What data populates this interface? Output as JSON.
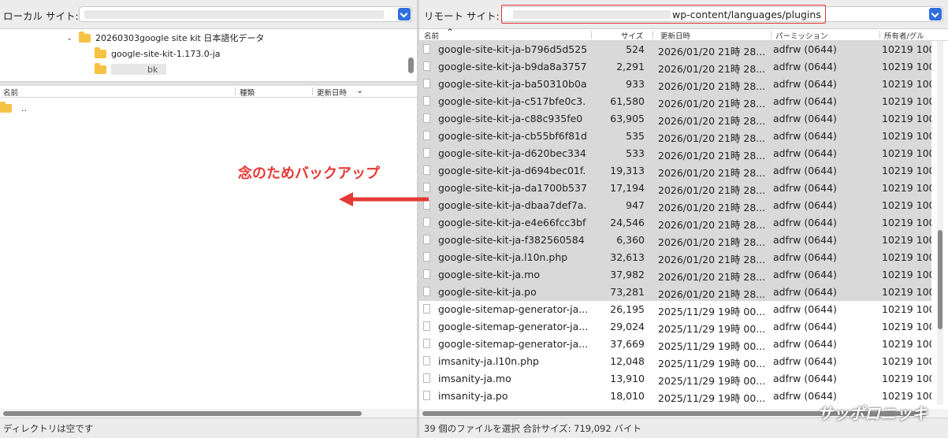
{
  "local": {
    "site_label": "ローカル サイト:",
    "tree": [
      {
        "label": "20260303google site kit 日本語化データ"
      },
      {
        "label": "google-site-kit-1.173.0-ja"
      },
      {
        "label": "bk"
      }
    ],
    "columns": [
      "名前",
      "種類",
      "更新日時"
    ],
    "parent_dir": "..",
    "status": "ディレクトリは空です"
  },
  "remote": {
    "site_label": "リモート サイト:",
    "path": "wp-content/languages/plugins",
    "columns": [
      "名前",
      "サイズ",
      "更新日時",
      "パーミッション",
      "所有者/グル"
    ],
    "files": [
      {
        "name": "google-site-kit-ja-b796d5d525",
        "size": "524",
        "date": "2026/01/20 21時 28...",
        "perm": "adfrw (0644)",
        "owner": "10219 100",
        "selected": true
      },
      {
        "name": "google-site-kit-ja-b9da8a3757",
        "size": "2,291",
        "date": "2026/01/20 21時 28...",
        "perm": "adfrw (0644)",
        "owner": "10219 100",
        "selected": true
      },
      {
        "name": "google-site-kit-ja-ba50310b0a",
        "size": "933",
        "date": "2026/01/20 21時 28...",
        "perm": "adfrw (0644)",
        "owner": "10219 100",
        "selected": true
      },
      {
        "name": "google-site-kit-ja-c517bfe0c3.",
        "size": "61,580",
        "date": "2026/01/20 21時 28...",
        "perm": "adfrw (0644)",
        "owner": "10219 100",
        "selected": true
      },
      {
        "name": "google-site-kit-ja-c88c935fe0",
        "size": "63,905",
        "date": "2026/01/20 21時 28...",
        "perm": "adfrw (0644)",
        "owner": "10219 100",
        "selected": true
      },
      {
        "name": "google-site-kit-ja-cb55bf6f81d",
        "size": "535",
        "date": "2026/01/20 21時 28...",
        "perm": "adfrw (0644)",
        "owner": "10219 100",
        "selected": true
      },
      {
        "name": "google-site-kit-ja-d620bec334",
        "size": "533",
        "date": "2026/01/20 21時 28...",
        "perm": "adfrw (0644)",
        "owner": "10219 100",
        "selected": true
      },
      {
        "name": "google-site-kit-ja-d694bec01f.",
        "size": "19,313",
        "date": "2026/01/20 21時 28...",
        "perm": "adfrw (0644)",
        "owner": "10219 100",
        "selected": true
      },
      {
        "name": "google-site-kit-ja-da1700b537",
        "size": "17,194",
        "date": "2026/01/20 21時 28...",
        "perm": "adfrw (0644)",
        "owner": "10219 100",
        "selected": true
      },
      {
        "name": "google-site-kit-ja-dbaa7def7a.",
        "size": "947",
        "date": "2026/01/20 21時 28...",
        "perm": "adfrw (0644)",
        "owner": "10219 100",
        "selected": true
      },
      {
        "name": "google-site-kit-ja-e4e66fcc3bf",
        "size": "24,546",
        "date": "2026/01/20 21時 28...",
        "perm": "adfrw (0644)",
        "owner": "10219 100",
        "selected": true
      },
      {
        "name": "google-site-kit-ja-f382560584",
        "size": "6,360",
        "date": "2026/01/20 21時 28...",
        "perm": "adfrw (0644)",
        "owner": "10219 100",
        "selected": true
      },
      {
        "name": "google-site-kit-ja.l10n.php",
        "size": "32,613",
        "date": "2026/01/20 21時 28...",
        "perm": "adfrw (0644)",
        "owner": "10219 100",
        "selected": true
      },
      {
        "name": "google-site-kit-ja.mo",
        "size": "37,982",
        "date": "2026/01/20 21時 28...",
        "perm": "adfrw (0644)",
        "owner": "10219 100",
        "selected": true
      },
      {
        "name": "google-site-kit-ja.po",
        "size": "73,281",
        "date": "2026/01/20 21時 28...",
        "perm": "adfrw (0644)",
        "owner": "10219 100",
        "selected": true
      },
      {
        "name": "google-sitemap-generator-ja...",
        "size": "26,195",
        "date": "2025/11/29 19時 00...",
        "perm": "adfrw (0644)",
        "owner": "10219 100",
        "selected": false
      },
      {
        "name": "google-sitemap-generator-ja...",
        "size": "29,024",
        "date": "2025/11/29 19時 00...",
        "perm": "adfrw (0644)",
        "owner": "10219 100",
        "selected": false
      },
      {
        "name": "google-sitemap-generator-ja...",
        "size": "37,669",
        "date": "2025/11/29 19時 00...",
        "perm": "adfrw (0644)",
        "owner": "10219 100",
        "selected": false
      },
      {
        "name": "imsanity-ja.l10n.php",
        "size": "12,048",
        "date": "2025/11/29 19時 00...",
        "perm": "adfrw (0644)",
        "owner": "10219 100",
        "selected": false
      },
      {
        "name": "imsanity-ja.mo",
        "size": "13,910",
        "date": "2025/11/29 19時 00...",
        "perm": "adfrw (0644)",
        "owner": "10219 100",
        "selected": false
      },
      {
        "name": "imsanity-ja.po",
        "size": "18,010",
        "date": "2025/11/29 19時 00...",
        "perm": "adfrw (0644)",
        "owner": "10219 100",
        "selected": false
      }
    ],
    "status": "39 個のファイルを選択 合計サイズ: 719,092 バイト"
  },
  "annotation": {
    "text": "念のためバックアップ",
    "color": "#e53935"
  },
  "watermark": "サッポロニッキ",
  "icons": {
    "dropdown": "chevron-down-icon",
    "folder": "folder-icon",
    "file": "file-icon",
    "sort": "sort-ascending-icon",
    "arrow": "arrow-left-icon"
  },
  "colors": {
    "accent": "#2f6fde",
    "selection": "#d9d9d9",
    "highlight": "#e53935"
  }
}
